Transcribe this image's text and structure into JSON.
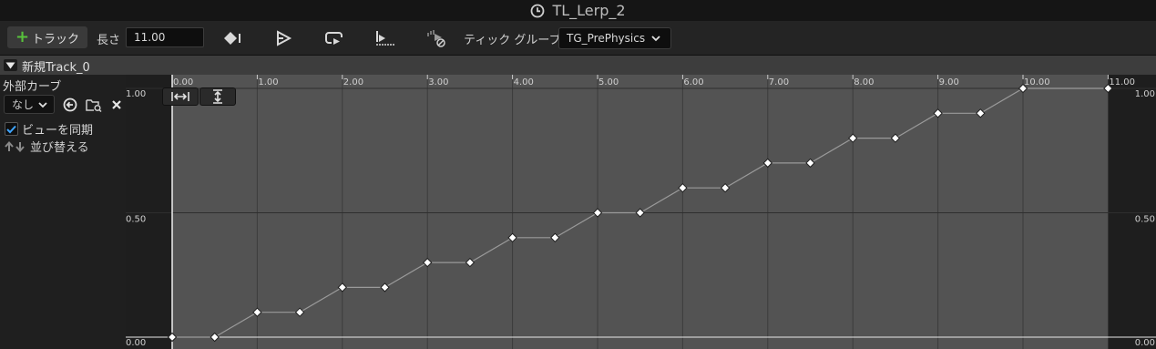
{
  "title": "TL_Lerp_2",
  "toolbar": {
    "add_track_label": "トラック",
    "length_label": "長さ",
    "length_value": "11.00",
    "tick_group_label": "ティック グループ",
    "tick_group_value": "TG_PrePhysics"
  },
  "track": {
    "name": "新規Track_0"
  },
  "left_panel": {
    "external_curve_label": "外部カーブ",
    "curve_select_value": "なし",
    "sync_view_label": "ビューを同期",
    "sync_view_checked": true,
    "sort_label": "並び替える"
  },
  "chart_data": {
    "type": "line",
    "x_ticks": [
      "0.00",
      "1.00",
      "2.00",
      "3.00",
      "4.00",
      "5.00",
      "6.00",
      "7.00",
      "8.00",
      "9.00",
      "10.00",
      "11.00"
    ],
    "y_ticks_left": [
      "1.00",
      "0.50",
      "0.00"
    ],
    "y_ticks_right": [
      "1.00",
      "0.50",
      "0.00"
    ],
    "xlim": [
      0,
      11
    ],
    "ylim": [
      0,
      1
    ],
    "keys": [
      {
        "x": 0.0,
        "y": 0.0
      },
      {
        "x": 0.5,
        "y": 0.0
      },
      {
        "x": 1.0,
        "y": 0.1
      },
      {
        "x": 1.5,
        "y": 0.1
      },
      {
        "x": 2.0,
        "y": 0.2
      },
      {
        "x": 2.5,
        "y": 0.2
      },
      {
        "x": 3.0,
        "y": 0.3
      },
      {
        "x": 3.5,
        "y": 0.3
      },
      {
        "x": 4.0,
        "y": 0.4
      },
      {
        "x": 4.5,
        "y": 0.4
      },
      {
        "x": 5.0,
        "y": 0.5
      },
      {
        "x": 5.5,
        "y": 0.5
      },
      {
        "x": 6.0,
        "y": 0.6
      },
      {
        "x": 6.5,
        "y": 0.6
      },
      {
        "x": 7.0,
        "y": 0.7
      },
      {
        "x": 7.5,
        "y": 0.7
      },
      {
        "x": 8.0,
        "y": 0.8
      },
      {
        "x": 8.5,
        "y": 0.8
      },
      {
        "x": 9.0,
        "y": 0.9
      },
      {
        "x": 9.5,
        "y": 0.9
      },
      {
        "x": 10.0,
        "y": 1.0
      },
      {
        "x": 11.0,
        "y": 1.0
      }
    ],
    "colors": {
      "active_bg": "#535353",
      "inactive_bg": "#1e1e1e",
      "curve": "#9a9a9a",
      "key": "#ffffff"
    }
  }
}
